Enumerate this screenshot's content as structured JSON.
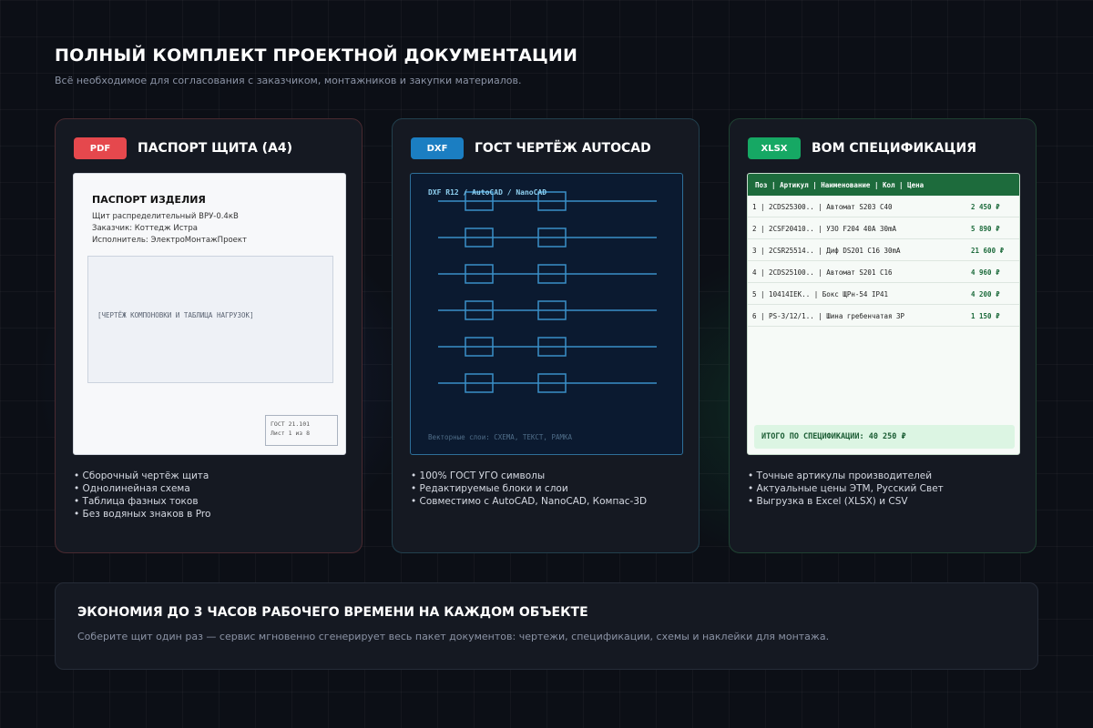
{
  "header": {
    "title": "ПОЛНЫЙ КОМПЛЕКТ ПРОЕКТНОЙ ДОКУМЕНТАЦИИ",
    "subtitle": "Всё необходимое для согласования с заказчиком, монтажников и закупки материалов."
  },
  "colors": {
    "pdf": "#e5484d",
    "dxf": "#1b7ec2",
    "xlsx": "#16a864"
  },
  "cards": {
    "pdf": {
      "badge": "PDF",
      "title": "ПАСПОРТ ЩИТА (А4)",
      "preview": {
        "heading": "ПАСПОРТ ИЗДЕЛИЯ",
        "lines": [
          "Щит распределительный ВРУ-0.4кВ",
          "Заказчик: Коттедж Истра",
          "Исполнитель: ЭлектроМонтажПроект"
        ],
        "drawing_label": "[ЧЕРТЁЖ КОМПОНОВКИ И ТАБЛИЦА НАГРУЗОК]",
        "stamp": [
          "ГОСТ 21.101",
          "Лист 1 из 8"
        ]
      },
      "bullets": [
        "• Сборочный чертёж щита",
        "• Однолинейная схема",
        "• Таблица фазных токов",
        "• Без водяных знаков в Pro"
      ]
    },
    "dxf": {
      "badge": "DXF",
      "title": "ГОСТ ЧЕРТЁЖ AUTOCAD",
      "preview": {
        "header": "DXF R12 / AutoCAD / NanoCAD",
        "footer": "Векторные слои: СХЕМА, ТЕКСТ, РАМКА"
      },
      "bullets": [
        "• 100% ГОСТ УГО символы",
        "• Редактируемые блоки и слои",
        "• Совместимо с AutoCAD, NanoCAD, Компас-3D"
      ]
    },
    "xlsx": {
      "badge": "XLSX",
      "title": "BOM СПЕЦИФИКАЦИЯ",
      "preview": {
        "header": "Поз | Артикул | Наименование | Кол | Цена",
        "rows": [
          {
            "text": "1 | 2CDS25300.. | Автомат S203 C40",
            "price": "2 450 ₽"
          },
          {
            "text": "2 | 2CSF20410.. | УЗО F204 40A 30mA",
            "price": "5 890 ₽"
          },
          {
            "text": "3 | 2CSR25514.. | Диф DS201 C16 30mA",
            "price": "21 600 ₽"
          },
          {
            "text": "4 | 2CDS25100.. | Автомат S201 C16",
            "price": "4 960 ₽"
          },
          {
            "text": "5 | 10414IEK.. | Бокс ЩРн-54 IP41",
            "price": "4 200 ₽"
          },
          {
            "text": "6 | PS-3/12/1.. | Шина гребенчатая 3P",
            "price": "1 150 ₽"
          }
        ],
        "total": "ИТОГО ПО СПЕЦИФИКАЦИИ: 40 250 ₽"
      },
      "bullets": [
        "• Точные артикулы производителей",
        "• Актуальные цены ЭТМ, Русский Свет",
        "• Выгрузка в Excel (XLSX) и CSV"
      ]
    }
  },
  "banner": {
    "title": "ЭКОНОМИЯ ДО 3 ЧАСОВ РАБОЧЕГО ВРЕМЕНИ НА КАЖДОМ ОБЪЕКТЕ",
    "text": "Соберите щит один раз — сервис мгновенно сгенерирует весь пакет документов: чертежи, спецификации, схемы и наклейки для монтажа."
  }
}
